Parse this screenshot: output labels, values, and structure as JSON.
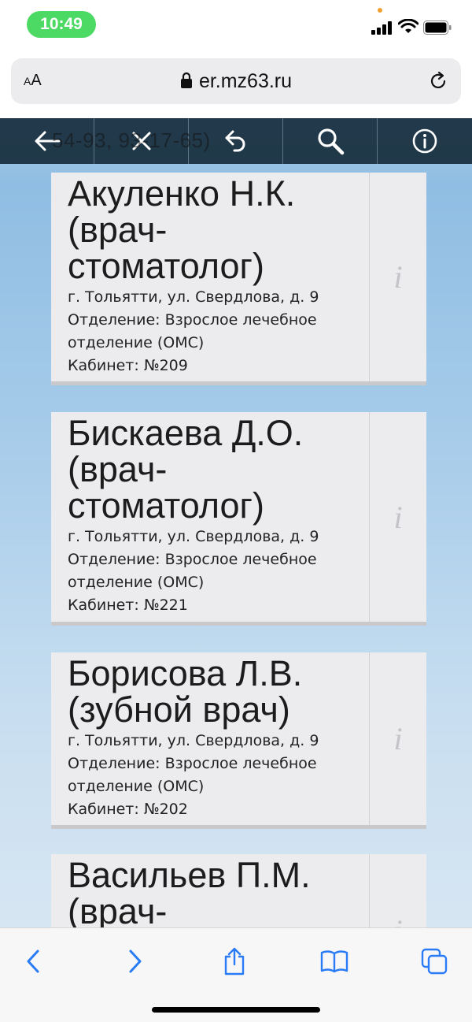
{
  "status": {
    "time": "10:49"
  },
  "browser": {
    "aa_small": "A",
    "aa_big": "A",
    "url": "er.mz63.ru"
  },
  "toolbar": {
    "ghost_text": "54-93, 93-17-65)"
  },
  "doctors": [
    {
      "name_lines": [
        "Акуленко Н.К.",
        "(врач-",
        "стоматолог)"
      ],
      "address": "г. Тольятти, ул. Свердлова, д. 9",
      "department_line1": "Отделение: Взрослое лечебное",
      "department_line2": "отделение (ОМС)",
      "cabinet": "Кабинет: №209",
      "info": "i"
    },
    {
      "name_lines": [
        "Бискаева Д.О.",
        "(врач-",
        "стоматолог)"
      ],
      "address": "г. Тольятти, ул. Свердлова, д. 9",
      "department_line1": "Отделение: Взрослое лечебное",
      "department_line2": "отделение (ОМС)",
      "cabinet": "Кабинет: №221",
      "info": "i"
    },
    {
      "name_lines": [
        "Борисова Л.В.",
        "(зубной врач)"
      ],
      "address": "г. Тольятти, ул. Свердлова, д. 9",
      "department_line1": "Отделение: Взрослое лечебное",
      "department_line2": "отделение (ОМС)",
      "cabinet": "Кабинет: №202",
      "info": "i"
    },
    {
      "name_lines": [
        "Васильев П.М.",
        "(врач-"
      ],
      "info": "i"
    }
  ]
}
